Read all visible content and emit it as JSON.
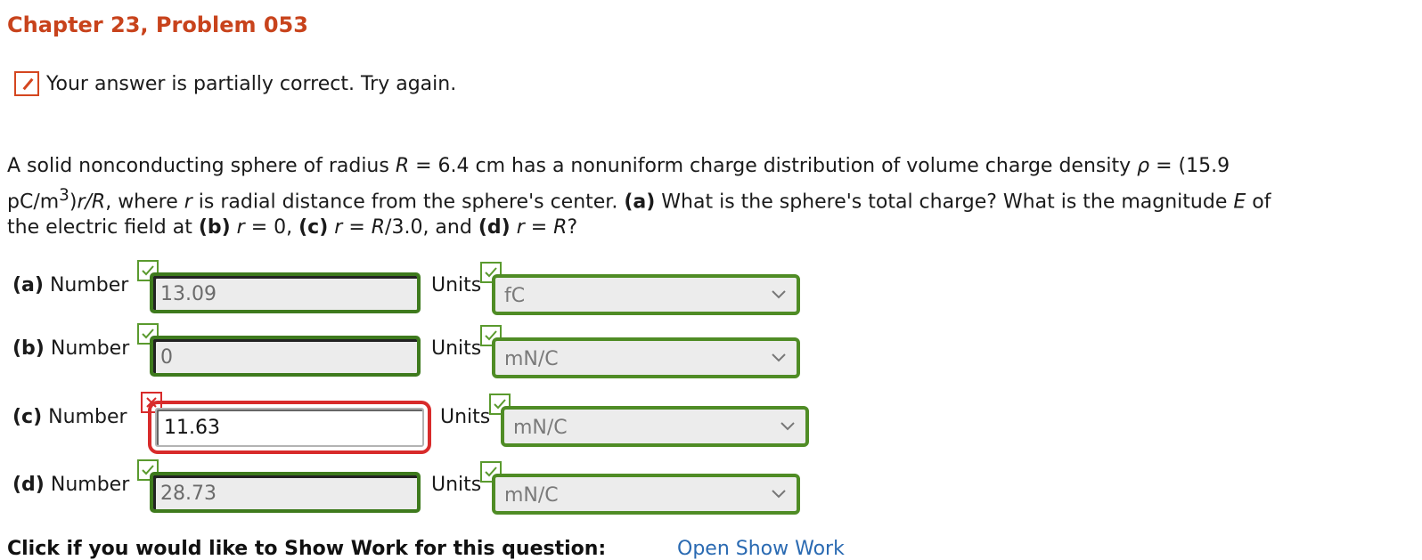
{
  "header": {
    "title": "Chapter 23, Problem 053"
  },
  "status": {
    "icon": "pencil-icon",
    "message": "Your answer is partially correct.  Try again.",
    "color": "#d4461f"
  },
  "problem": {
    "line1_a": "A solid nonconducting sphere of radius ",
    "line1_R": "R",
    "line1_b": " = 6.4 cm has a nonuniform charge distribution of volume charge density ",
    "line1_rho": "ρ",
    "line1_c": " = (15.9",
    "line2_a": "pC/m",
    "line2_sup": "3",
    "line2_b": ")",
    "line2_r": "r",
    "line2_slash": "/",
    "line2_R": "R",
    "line2_c": ", where ",
    "line2_r2": "r",
    "line2_d": " is radial distance from the sphere's center. ",
    "part_a": "(a)",
    "line2_e": " What is the sphere's total charge? What is the magnitude ",
    "line2_E": "E",
    "line2_f": " of",
    "line3_a": "the electric field at ",
    "part_b": "(b)",
    "line3_r1": "r",
    "line3_b": " = 0, ",
    "part_c": "(c)",
    "line3_r2": "r",
    "line3_c": " = ",
    "line3_R1": "R",
    "line3_d": "/3.0, and ",
    "part_d": "(d)",
    "line3_r3": "r",
    "line3_e": " = ",
    "line3_R2": "R",
    "line3_f": "?"
  },
  "answers": [
    {
      "part": "(a)",
      "number_label": "Number",
      "value": "13.09",
      "number_status": "correct",
      "units_label": "Units",
      "unit": "fC",
      "unit_status": "correct"
    },
    {
      "part": "(b)",
      "number_label": "Number",
      "value": "0",
      "number_status": "correct",
      "units_label": "Units",
      "unit": "mN/C",
      "unit_status": "correct"
    },
    {
      "part": "(c)",
      "number_label": "Number",
      "value": "11.63",
      "number_status": "incorrect",
      "units_label": "Units",
      "unit": "mN/C",
      "unit_status": "correct"
    },
    {
      "part": "(d)",
      "number_label": "Number",
      "value": "28.73",
      "number_status": "correct",
      "units_label": "Units",
      "unit": "mN/C",
      "unit_status": "correct"
    }
  ],
  "footer": {
    "show_work_text": "Click if you would like to Show Work for this question:",
    "show_work_link": "Open Show Work"
  },
  "colors": {
    "correct": "#4f8c25",
    "incorrect": "#d82b2b",
    "title": "#c8431c",
    "link": "#2a6ab2"
  }
}
